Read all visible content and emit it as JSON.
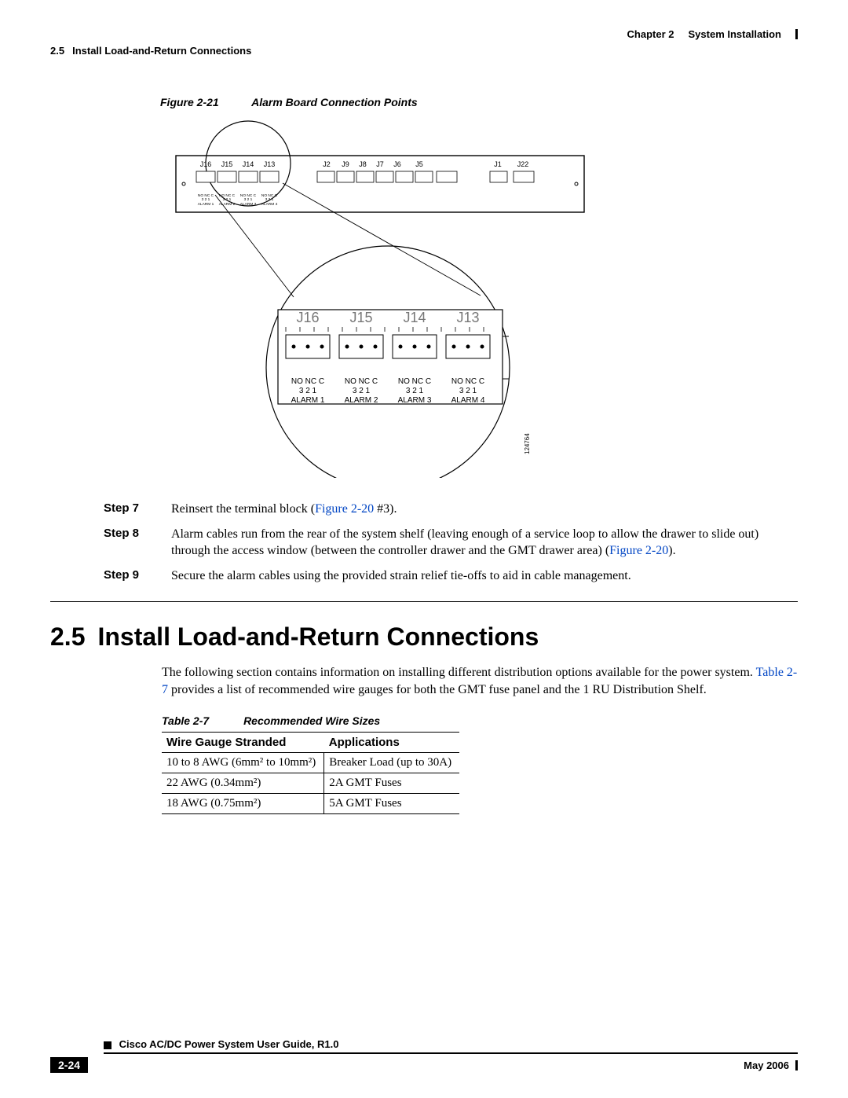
{
  "header": {
    "chapter_label": "Chapter 2",
    "chapter_title": "System Installation",
    "section_number": "2.5",
    "section_title": "Install Load-and-Return Connections"
  },
  "figure": {
    "number": "Figure 2-21",
    "title": "Alarm Board Connection Points",
    "top_labels": [
      "J16",
      "J15",
      "J14",
      "J13",
      "J2",
      "J9",
      "J8",
      "J7",
      "J6",
      "J5",
      "J1",
      "J22"
    ],
    "alarm_small_labels": [
      "NO NC C 3 2 1 ALARM 1",
      "NO NC C 3 2 1 ALARM 2",
      "NO NC C 3 2 1 ALARM 3",
      "NO NC C 3 2 1 ALARM 4"
    ],
    "zoom_labels": [
      "J16",
      "J15",
      "J14",
      "J13"
    ],
    "zoom_pin_row1": [
      "NO NC C",
      "NO NC C",
      "NO NC C",
      "NO NC C"
    ],
    "zoom_pin_row2": [
      "3   2   1",
      "3   2   1",
      "3   2   1",
      "3   2   1"
    ],
    "zoom_alarms": [
      "ALARM 1",
      "ALARM 2",
      "ALARM 3",
      "ALARM 4"
    ],
    "drawing_id": "124764"
  },
  "steps": [
    {
      "label": "Step 7",
      "pre": "Reinsert the terminal block (",
      "xref": "Figure 2-20",
      "post": " #3)."
    },
    {
      "label": "Step 8",
      "pre": "Alarm cables run from the rear of the system shelf (leaving enough of a service loop to allow the drawer to slide out) through the access window (between the controller drawer and the GMT drawer area) (",
      "xref": "Figure 2-20",
      "post": ")."
    },
    {
      "label": "Step 9",
      "pre": "Secure the alarm cables using the provided strain relief tie-offs to aid in cable management.",
      "xref": "",
      "post": ""
    }
  ],
  "section": {
    "number": "2.5",
    "title": "Install Load-and-Return Connections",
    "intro_pre": "The following section contains information on installing different distribution options available for the power system. ",
    "intro_xref": "Table 2-7",
    "intro_post": " provides a list of recommended wire gauges for both the GMT fuse panel and the 1 RU Distribution Shelf."
  },
  "table": {
    "number": "Table 2-7",
    "title": "Recommended Wire Sizes",
    "headers": [
      "Wire Gauge Stranded",
      "Applications"
    ],
    "rows": [
      {
        "gauge": "10 to 8 AWG (6mm² to 10mm²)",
        "app": "Breaker Load (up to 30A)"
      },
      {
        "gauge": "22 AWG (0.34mm²)",
        "app": "2A GMT Fuses"
      },
      {
        "gauge": "18 AWG (0.75mm²)",
        "app": "5A GMT Fuses"
      }
    ]
  },
  "footer": {
    "doc_title": "Cisco AC/DC Power System User Guide, R1.0",
    "page": "2-24",
    "pub_date": "May 2006"
  }
}
